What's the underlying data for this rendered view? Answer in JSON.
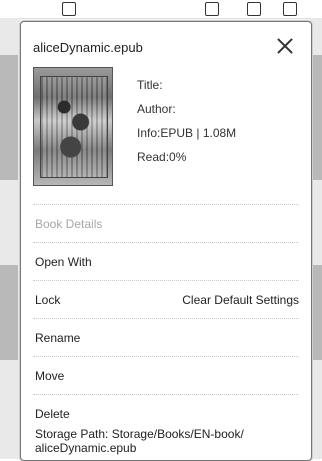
{
  "dialog": {
    "filename": "aliceDynamic.epub",
    "info": {
      "title": "Title:",
      "author": "Author:",
      "info": "Info:EPUB | 1.08M",
      "read": "Read:0%"
    },
    "menu": {
      "book_details": "Book Details",
      "open_with": "Open With",
      "lock": "Lock",
      "clear_default_settings": "Clear Default Settings",
      "rename": "Rename",
      "move": "Move",
      "delete": "Delete"
    },
    "storage": {
      "line1": "Storage Path: Storage/Books/EN-book/",
      "line2": "aliceDynamic.epub"
    }
  },
  "icons": {
    "close": "close-icon",
    "cover": "book-cover-image"
  },
  "colors": {
    "disabled_text": "#a7a7a7",
    "text": "#222222"
  }
}
